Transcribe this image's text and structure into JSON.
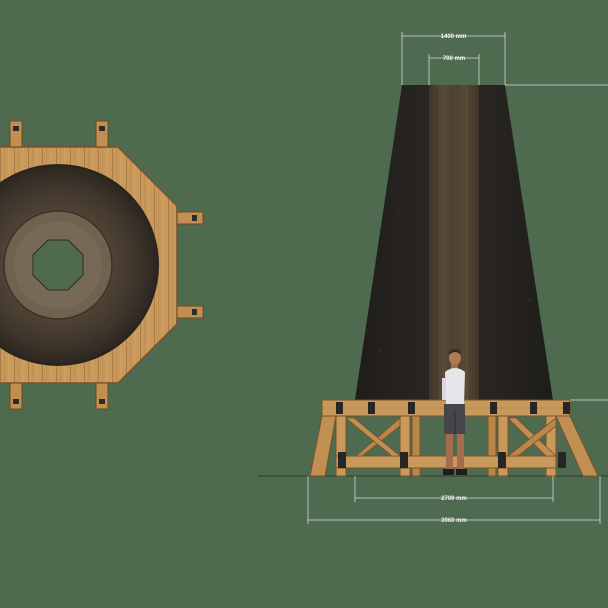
{
  "dimensions": {
    "top_width": "1400 mm",
    "core_width": "700 mm",
    "base_inner_width": "2700 mm",
    "base_outer_width": "3960 mm"
  },
  "colors": {
    "background": "#4f6b4f",
    "timber": "#c89a5c",
    "timber_dark": "#9a6d3a",
    "cone_dark": "#262420",
    "core_brown": "#4a3e30",
    "dimension_line": "#d9d9d9"
  }
}
